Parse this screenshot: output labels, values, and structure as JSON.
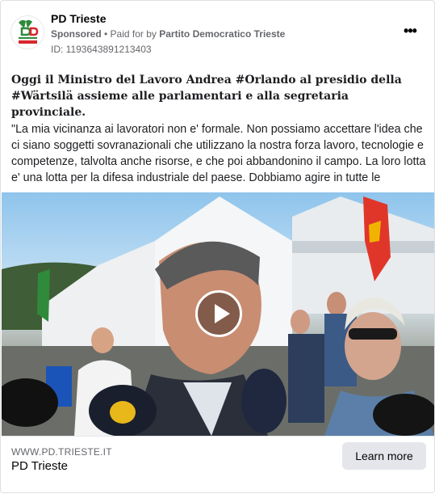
{
  "header": {
    "page_name": "PD Trieste",
    "sponsored": "Sponsored",
    "separator": " • ",
    "paid_for_prefix": "Paid for by ",
    "payer": "Partito Democratico Trieste",
    "ad_id": "ID: 1193643891213403",
    "more_icon": "more-horizontal-icon",
    "more_glyph": "•••"
  },
  "post": {
    "headline": "Oggi il Ministro del Lavoro Andrea #Orlando al presidio della #Wärtsilä assieme alle parlamentari e alla segretaria provinciale.",
    "body": "\"La mia vicinanza ai lavoratori non e' formale. Non possiamo accettare l'idea che ci siano soggetti sovranazionali che utilizzano la nostra forza lavoro, tecnologie e competenze, talvolta anche risorse, e che poi abbandonino il campo. La loro lotta e' una lotta per la difesa industriale del paese. Dobbiamo agire in tutte le direzioni…"
  },
  "media": {
    "type": "video",
    "play_icon": "play-icon"
  },
  "footer": {
    "domain": "WWW.PD.TRIESTE.IT",
    "title": "PD Trieste",
    "cta": "Learn more"
  },
  "colors": {
    "secondary_text": "#65676b",
    "button_bg": "#e4e6eb",
    "pd_green": "#2e8b3a",
    "pd_red": "#d7262e"
  }
}
